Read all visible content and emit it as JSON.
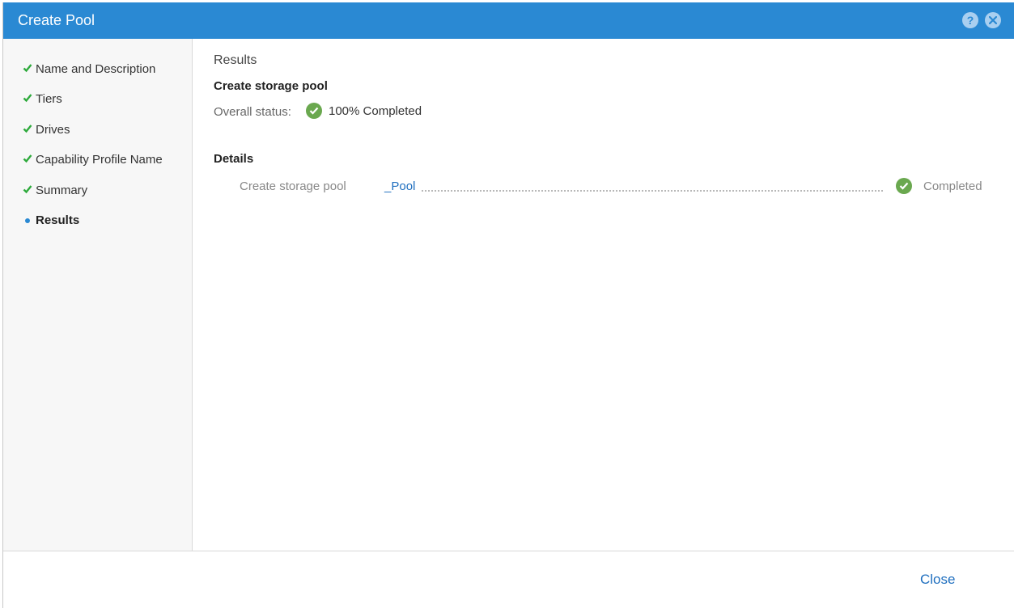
{
  "dialog": {
    "title": "Create Pool",
    "help_icon": "help-icon",
    "close_icon": "close-icon"
  },
  "steps": [
    {
      "label": "Name and Description",
      "state": "done",
      "icon": "check-icon"
    },
    {
      "label": "Tiers",
      "state": "done",
      "icon": "check-icon"
    },
    {
      "label": "Drives",
      "state": "done",
      "icon": "check-icon"
    },
    {
      "label": "Capability Profile Name",
      "state": "done",
      "icon": "check-icon"
    },
    {
      "label": "Summary",
      "state": "done",
      "icon": "check-icon"
    },
    {
      "label": "Results",
      "state": "active",
      "icon": "current-step-dot"
    }
  ],
  "results": {
    "heading": "Results",
    "operation": "Create storage pool",
    "overall_label": "Overall status:",
    "overall_value": "100% Completed",
    "details_heading": "Details",
    "details": [
      {
        "task": "Create storage pool",
        "object": "_Pool",
        "status": "Completed"
      }
    ]
  },
  "footer": {
    "close_label": "Close"
  },
  "colors": {
    "titlebar": "#2a89d3",
    "success": "#6aa84f",
    "step_check": "#2eaa3c",
    "link": "#1f6fbf"
  }
}
